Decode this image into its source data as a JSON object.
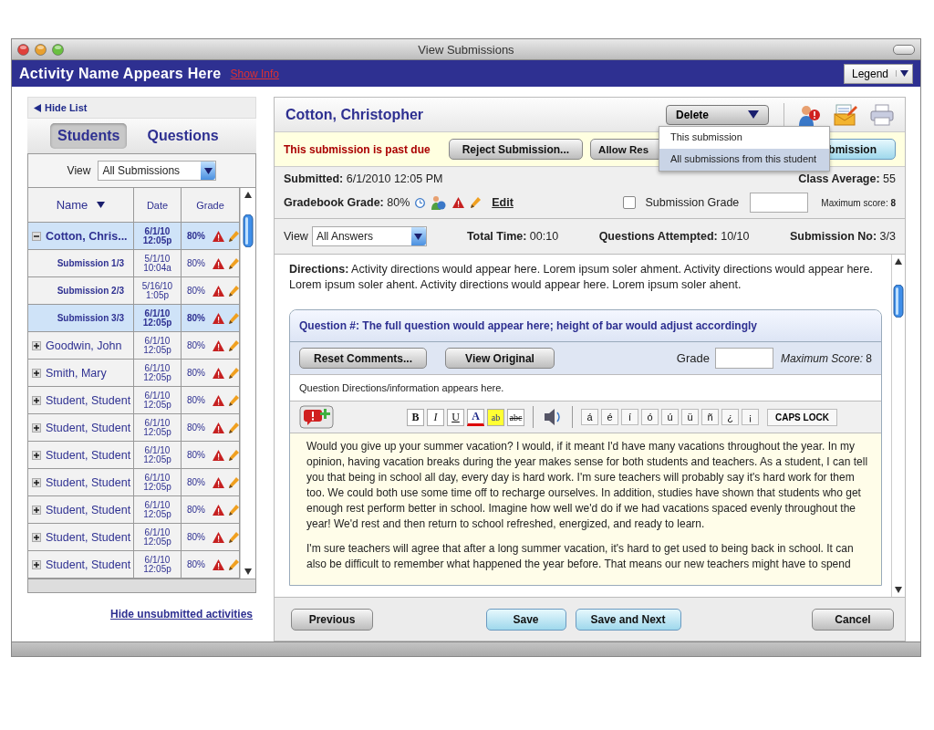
{
  "window": {
    "title": "View Submissions"
  },
  "header": {
    "activity_title": "Activity Name Appears Here",
    "show_info": "Show Info",
    "legend": "Legend"
  },
  "sidebar": {
    "hide_list": "Hide List",
    "tabs": [
      {
        "label": "Students",
        "selected": true
      },
      {
        "label": "Questions",
        "selected": false
      }
    ],
    "view": {
      "label": "View",
      "value": "All Submissions"
    },
    "columns": [
      "Name",
      "Date",
      "Grade"
    ],
    "rows": [
      {
        "name": "Cotton, Chris...",
        "date": "6/1/10 12:05p",
        "grade": "80%",
        "expanded": true,
        "selected": true,
        "children": [
          {
            "name": "Submission 1/3",
            "date": "5/1/10 10:04a",
            "grade": "80%",
            "selected": false
          },
          {
            "name": "Submission 2/3",
            "date": "5/16/10 1:05p",
            "grade": "80%",
            "selected": false
          },
          {
            "name": "Submission 3/3",
            "date": "6/1/10 12:05p",
            "grade": "80%",
            "selected": true
          }
        ]
      },
      {
        "name": "Goodwin, John",
        "date": "6/1/10 12:05p",
        "grade": "80%",
        "expanded": false,
        "selected": false
      },
      {
        "name": "Smith, Mary",
        "date": "6/1/10 12:05p",
        "grade": "80%",
        "expanded": false,
        "selected": false
      },
      {
        "name": "Student, Student",
        "date": "6/1/10 12:05p",
        "grade": "80%",
        "expanded": false,
        "selected": false
      },
      {
        "name": "Student, Student",
        "date": "6/1/10 12:05p",
        "grade": "80%",
        "expanded": false,
        "selected": false
      },
      {
        "name": "Student, Student",
        "date": "6/1/10 12:05p",
        "grade": "80%",
        "expanded": false,
        "selected": false
      },
      {
        "name": "Student, Student",
        "date": "6/1/10 12:05p",
        "grade": "80%",
        "expanded": false,
        "selected": false
      },
      {
        "name": "Student, Student",
        "date": "6/1/10 12:05p",
        "grade": "80%",
        "expanded": false,
        "selected": false
      },
      {
        "name": "Student, Student",
        "date": "6/1/10 12:05p",
        "grade": "80%",
        "expanded": false,
        "selected": false
      },
      {
        "name": "Student, Student",
        "date": "6/1/10 12:05p",
        "grade": "80%",
        "expanded": false,
        "selected": false
      }
    ],
    "hide_unsubmitted": "Hide unsubmitted activities"
  },
  "submission": {
    "student_name": "Cotton, Christopher",
    "delete_menu": {
      "label": "Delete",
      "items": [
        {
          "label": "This submission",
          "selected": false
        },
        {
          "label": "All submissions from this student",
          "selected": true
        }
      ]
    },
    "past_due": "This submission is past due",
    "notice_buttons": [
      {
        "label": "Reject Submission...",
        "kind": "plain"
      },
      {
        "label": "Allow Res",
        "kind": "plain"
      },
      {
        "label": "bmission",
        "kind": "primary"
      }
    ],
    "submitted": "**Submitted:** 6/1/2010 12:05 PM",
    "class_average": "**Class Average:** 55",
    "gradebook_grade": "**Gradebook Grade:** 80%",
    "edit": "Edit",
    "submission_grade": {
      "label": "Submission Grade",
      "checked": false
    },
    "maximum_score": "Maximum score: **8**",
    "view": {
      "label": "View",
      "value": "All Answers"
    },
    "stats": [
      "**Total Time:** 00:10",
      "**Questions Attempted:** 10/10",
      "**Submission No:** 3/3"
    ],
    "directions": "**Directions:**  Activity directions would appear here. Lorem ipsum soler ahment.  Activity directions would appear here. Lorem ipsum soler ahent. Activity directions would appear here. Lorem ipsum soler ahent.",
    "question": {
      "title": "Question #: The full question would appear here; height of bar would adjust accordingly",
      "buttons": [
        "Reset Comments...",
        "View Original"
      ],
      "grade_label": "Grade",
      "maximum_score": "*Maximum Score:* 8",
      "directions": "Question Directions/information appears here.",
      "format_buttons": [
        {
          "kind": "bold",
          "label": "B"
        },
        {
          "kind": "italic",
          "label": "I"
        },
        {
          "kind": "underline",
          "label": "U"
        },
        {
          "kind": "font-color",
          "label": "A"
        },
        {
          "kind": "highlight",
          "label": "ab"
        },
        {
          "kind": "strike",
          "label": "abc"
        }
      ],
      "characters": [
        "á",
        "é",
        "í",
        "ó",
        "ú",
        "ü",
        "ñ",
        "¿",
        "¡"
      ],
      "caps_lock": "CAPS LOCK",
      "answer": [
        "Would you give up your summer vacation? I would, if it meant I'd have many vacations throughout the year. In my opinion, having vacation breaks during the year makes sense for both students and teachers. As a student, I can tell you that being in school all day, every day is hard work. I'm sure teachers will probably say it's hard work for them too. We could both use some time off to recharge ourselves. In addition, studies have shown that students who get enough rest perform better in school. Imagine how well we'd do if we had vacations spaced evenly throughout the year! We'd rest and then return to school refreshed, energized, and ready to learn.",
        "I'm sure teachers will agree that after a long summer vacation, it's hard to get used to being back in school. It can also be difficult to remember what happened the year before. That means our new teachers might have to spend"
      ]
    },
    "footer_buttons": [
      {
        "label": "Previous",
        "kind": "plain"
      },
      {
        "label": "Save",
        "kind": "primary"
      },
      {
        "label": "Save and Next",
        "kind": "primary"
      },
      {
        "label": "Cancel",
        "kind": "plain"
      }
    ]
  }
}
